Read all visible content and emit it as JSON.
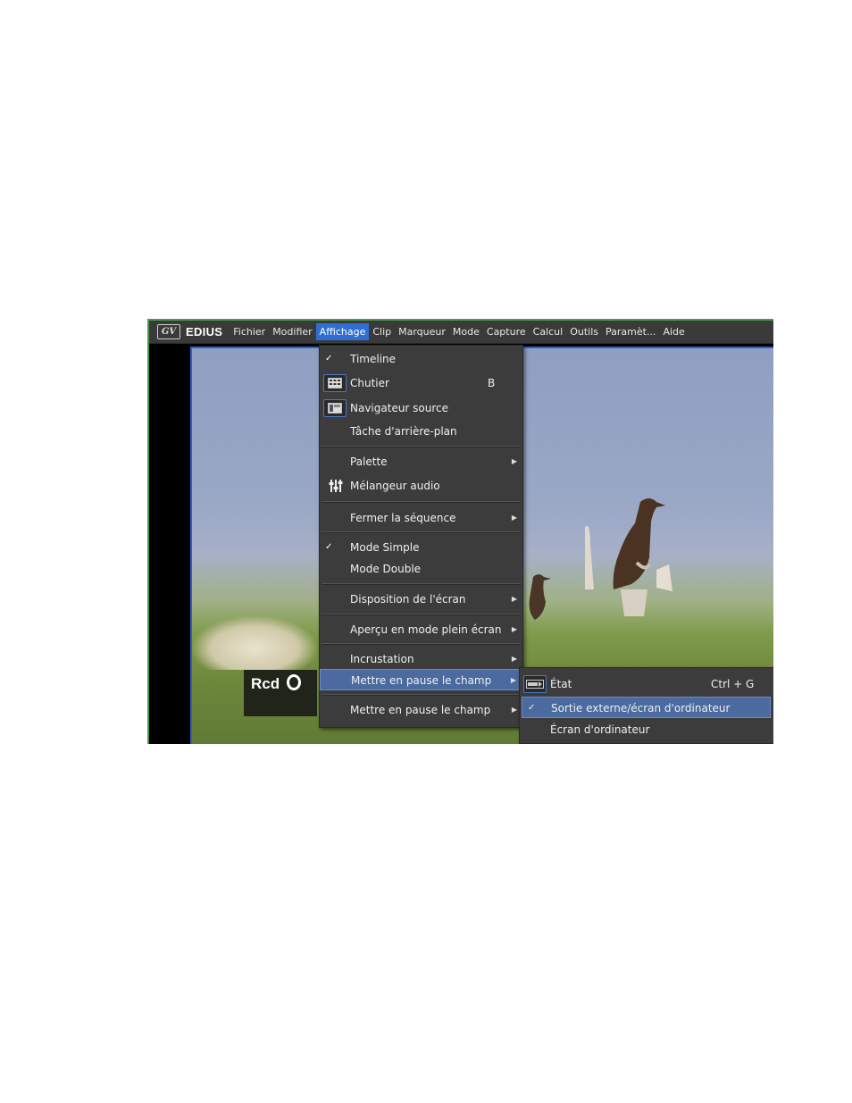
{
  "app": {
    "logo_text": "GV",
    "brand": "EDIUS"
  },
  "menubar": [
    "Fichier",
    "Modifier",
    "Affichage",
    "Clip",
    "Marqueur",
    "Mode",
    "Capture",
    "Calcul",
    "Outils",
    "Paramèt...",
    "Aide"
  ],
  "menubar_active": "Affichage",
  "overlay": {
    "text": "Rcd"
  },
  "menu": {
    "timeline": "Timeline",
    "chutier": "Chutier",
    "chutier_shortcut": "B",
    "navigateur": "Navigateur source",
    "tache": "Tâche d'arrière-plan",
    "palette": "Palette",
    "melangeur": "Mélangeur audio",
    "fermer": "Fermer la séquence",
    "mode_simple": "Mode Simple",
    "mode_double": "Mode Double",
    "disposition": "Disposition de l'écran",
    "apercu": "Aperçu en mode plein écran",
    "incrustation": "Incrustation",
    "pause1": "Mettre en pause le champ",
    "pause2": "Mettre en pause le champ"
  },
  "submenu": {
    "etat": "État",
    "etat_shortcut": "Ctrl + G",
    "sortie": "Sortie externe/écran d'ordinateur",
    "ecran": "Écran d'ordinateur"
  },
  "checkmark": "✓",
  "arrow": "▶",
  "colors": {
    "menu_bg": "#3c3c3c",
    "highlight": "#4a6aa0",
    "accent": "#2d6fd3"
  }
}
